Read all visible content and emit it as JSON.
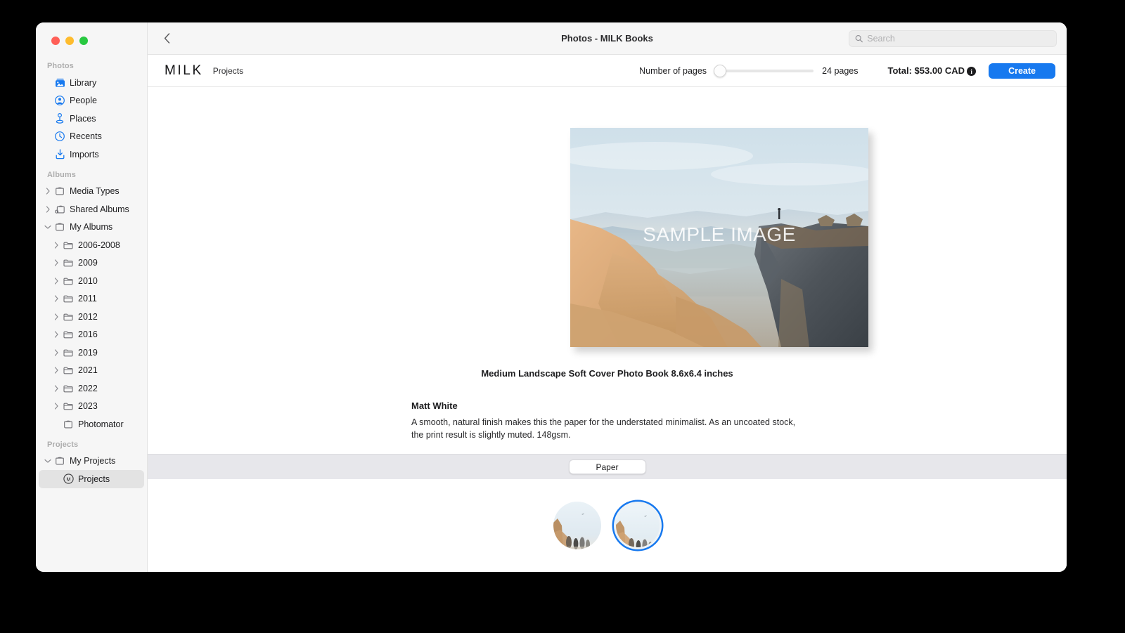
{
  "window": {
    "title": "Photos - MILK Books",
    "back_label": "Back",
    "traffic_lights": [
      "close",
      "minimize",
      "zoom"
    ]
  },
  "search": {
    "placeholder": "Search",
    "value": "",
    "icon": "search-icon"
  },
  "sidebar": {
    "sections": [
      {
        "header": "Photos",
        "items": [
          {
            "label": "Library",
            "icon": "library-icon",
            "twisty": "",
            "indent": 1,
            "selected": false
          },
          {
            "label": "People",
            "icon": "people-icon",
            "twisty": "",
            "indent": 1,
            "selected": false
          },
          {
            "label": "Places",
            "icon": "places-icon",
            "twisty": "",
            "indent": 1,
            "selected": false
          },
          {
            "label": "Recents",
            "icon": "recents-icon",
            "twisty": "",
            "indent": 1,
            "selected": false
          },
          {
            "label": "Imports",
            "icon": "imports-icon",
            "twisty": "",
            "indent": 1,
            "selected": false
          }
        ]
      },
      {
        "header": "Albums",
        "items": [
          {
            "label": "Media Types",
            "icon": "album-icon",
            "twisty": "right",
            "indent": 1,
            "selected": false
          },
          {
            "label": "Shared Albums",
            "icon": "shared-album-icon",
            "twisty": "right",
            "indent": 1,
            "selected": false
          },
          {
            "label": "My Albums",
            "icon": "album-icon",
            "twisty": "down",
            "indent": 1,
            "selected": false
          },
          {
            "label": "2006-2008",
            "icon": "folder-icon",
            "twisty": "right",
            "indent": 2,
            "selected": false
          },
          {
            "label": "2009",
            "icon": "folder-icon",
            "twisty": "right",
            "indent": 2,
            "selected": false
          },
          {
            "label": "2010",
            "icon": "folder-icon",
            "twisty": "right",
            "indent": 2,
            "selected": false
          },
          {
            "label": "2011",
            "icon": "folder-icon",
            "twisty": "right",
            "indent": 2,
            "selected": false
          },
          {
            "label": "2012",
            "icon": "folder-icon",
            "twisty": "right",
            "indent": 2,
            "selected": false
          },
          {
            "label": "2016",
            "icon": "folder-icon",
            "twisty": "right",
            "indent": 2,
            "selected": false
          },
          {
            "label": "2019",
            "icon": "folder-icon",
            "twisty": "right",
            "indent": 2,
            "selected": false
          },
          {
            "label": "2021",
            "icon": "folder-icon",
            "twisty": "right",
            "indent": 2,
            "selected": false
          },
          {
            "label": "2022",
            "icon": "folder-icon",
            "twisty": "right",
            "indent": 2,
            "selected": false
          },
          {
            "label": "2023",
            "icon": "folder-icon",
            "twisty": "right",
            "indent": 2,
            "selected": false
          },
          {
            "label": "Photomator",
            "icon": "album-icon",
            "twisty": "",
            "indent": 2,
            "selected": false
          }
        ]
      },
      {
        "header": "Projects",
        "items": [
          {
            "label": "My Projects",
            "icon": "album-icon",
            "twisty": "down",
            "indent": 1,
            "selected": false
          },
          {
            "label": "Projects",
            "icon": "milk-m-icon",
            "twisty": "",
            "indent": 2,
            "selected": true
          }
        ]
      }
    ]
  },
  "toolbar": {
    "brand": "MILK",
    "subtitle": "Projects",
    "pages_label": "Number of pages",
    "pages_value": "24 pages",
    "pages_number": 24,
    "slider_position_pct": 0,
    "total_label": "Total: $53.00 CAD",
    "total_amount": "53.00",
    "currency": "CAD",
    "info_icon": "info-icon",
    "create_label": "Create",
    "accent_color": "#1779ef"
  },
  "content": {
    "preview_watermark": "SAMPLE IMAGE",
    "book_title": "Medium Landscape Soft Cover Photo Book 8.6x6.4 inches",
    "paper_name": "Matt White",
    "paper_description": "A smooth, natural finish makes this the paper for the understated minimalist. As an uncoated stock, the print result is slightly muted. 148gsm."
  },
  "tabs": [
    {
      "label": "Paper",
      "selected": true
    }
  ],
  "swatches": [
    {
      "name": "paper-swatch-1",
      "selected": false
    },
    {
      "name": "paper-swatch-2",
      "selected": true
    }
  ]
}
